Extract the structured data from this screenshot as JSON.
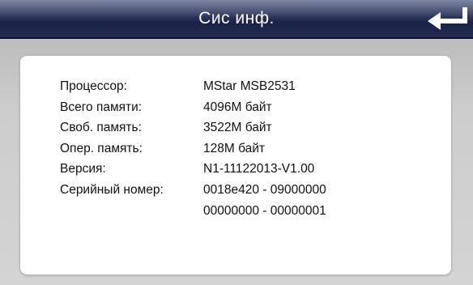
{
  "header": {
    "title": "Сис инф.",
    "back_icon": "return-arrow-icon"
  },
  "info": {
    "rows": [
      {
        "label": "Процессор:",
        "value": "MStar MSB2531"
      },
      {
        "label": "Всего памяти:",
        "value": "4096M байт"
      },
      {
        "label": "Своб. память:",
        "value": "3522M байт"
      },
      {
        "label": "Опер. память:",
        "value": "128M байт"
      },
      {
        "label": "Версия:",
        "value": "N1-11122013-V1.00"
      },
      {
        "label": "Серийный номер:",
        "value": "0018e420 - 09000000"
      },
      {
        "label": "",
        "value": "00000000 - 00000001"
      }
    ]
  },
  "colors": {
    "header_dark": "#1c2246",
    "header_light": "#5a6388",
    "background": "#d0d0d0",
    "card": "#ffffff"
  }
}
